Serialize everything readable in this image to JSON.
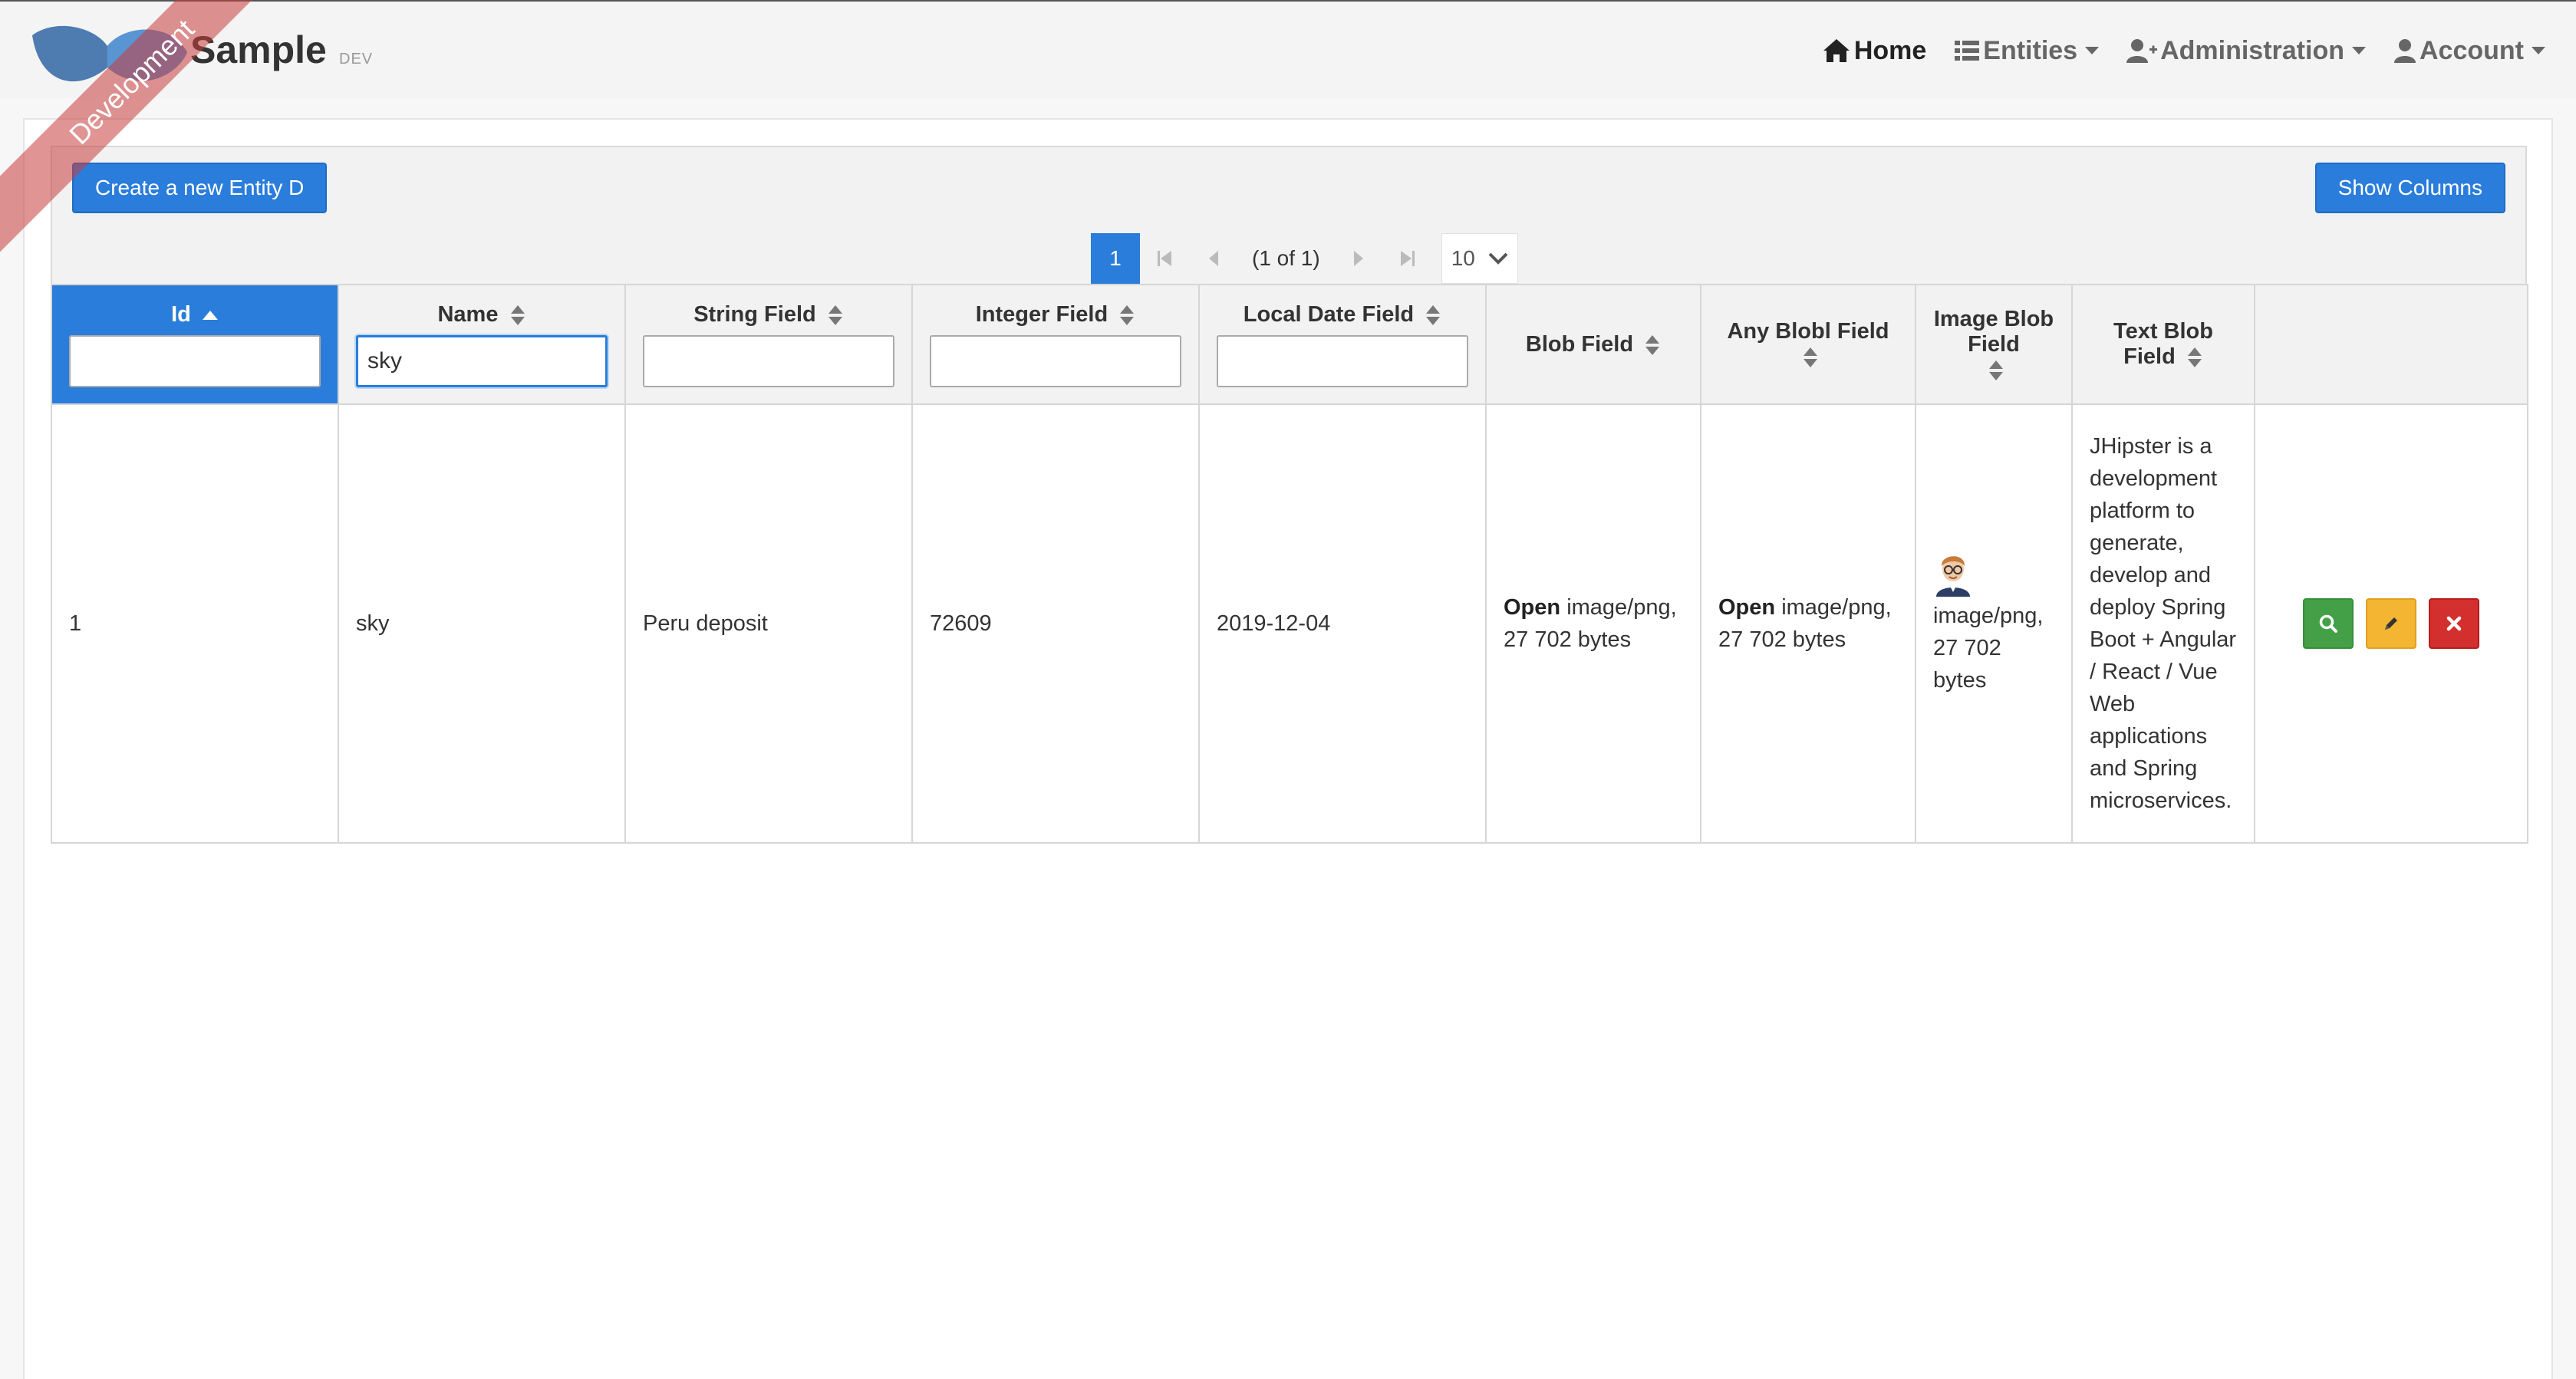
{
  "header": {
    "ribbon_text": "Development",
    "brand_title": "Sample",
    "brand_version": "DEV",
    "nav": [
      {
        "label": "Home",
        "icon": "home-icon",
        "active": true
      },
      {
        "label": "Entities",
        "icon": "list-icon",
        "dropdown": true
      },
      {
        "label": "Administration",
        "icon": "user-plus-icon",
        "dropdown": true
      },
      {
        "label": "Account",
        "icon": "user-icon",
        "dropdown": true
      }
    ]
  },
  "toolbar": {
    "create_label": "Create a new Entity D",
    "show_columns_label": "Show Columns"
  },
  "pager": {
    "current_page": "1",
    "report": "(1 of 1)",
    "rows_per_page": "10"
  },
  "table": {
    "columns": [
      {
        "label": "Id",
        "sorted": "asc",
        "filter": ""
      },
      {
        "label": "Name",
        "filter": "sky"
      },
      {
        "label": "String Field",
        "filter": ""
      },
      {
        "label": "Integer Field",
        "filter": ""
      },
      {
        "label": "Local Date Field",
        "filter": ""
      },
      {
        "label": "Blob Field"
      },
      {
        "label": "Any Blobl Field"
      },
      {
        "label": "Image Blob Field"
      },
      {
        "label": "Text Blob Field"
      },
      {
        "label": ""
      }
    ],
    "rows": [
      {
        "id": "1",
        "name": "sky",
        "string_field": "Peru deposit",
        "integer_field": "72609",
        "local_date_field": "2019-12-04",
        "blob_open": "Open",
        "blob_info": "image/png, 27 702 bytes",
        "any_blob_open": "Open",
        "any_blob_info": "image/png, 27 702 bytes",
        "image_blob_info": "image/png, 27 702 bytes",
        "text_blob": "JHipster is a development platform to generate, develop and deploy Spring Boot + Angular / React / Vue Web applications and Spring microservices."
      }
    ]
  },
  "colors": {
    "primary": "#2a7ddb",
    "success": "#43a047",
    "warning": "#f4b532",
    "danger": "#d32f2f"
  }
}
